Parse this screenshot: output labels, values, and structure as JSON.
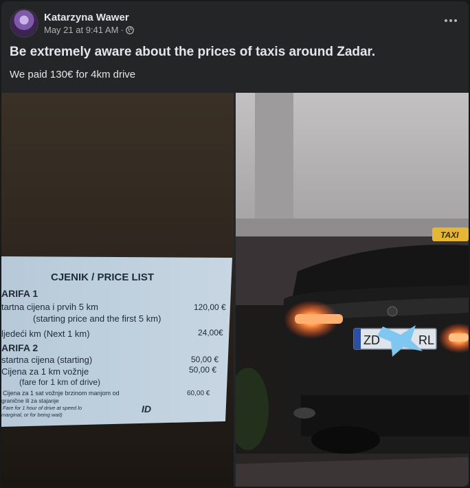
{
  "post": {
    "author": "Katarzyna Wawer",
    "timestamp": "May 21 at 9:41 AM",
    "separator": "·",
    "privacy_icon": "globe-icon",
    "more_icon": "more-horizontal-icon",
    "headline": "Be extremely aware about the prices of taxis around Zadar.",
    "body": "We paid 130€ for 4km drive"
  },
  "price_list": {
    "title": "CJENIK / PRICE LIST",
    "tariff1": "ARIFA 1",
    "row1_label": "tartna cijena i prvih 5 km",
    "row1_value": "120,00 €",
    "row1_en": "(starting price and the first 5 km)",
    "row2_label": "ljedeći km (Next 1 km)",
    "row2_value": "24,00€",
    "tariff2": "ARIFA 2",
    "row3_label": "startna cijena (starting)",
    "row3_value": "50,00 €",
    "row4_label": "Cijena za 1 km vožnje",
    "row4_value": "50,00 €",
    "row4_en": "(fare for 1 km of drive)",
    "row5_label": "Cijena za 1 sat vožnje brzinom manjom od",
    "row5_value": "60,00 €",
    "fine1": "granične ili za stajanje",
    "fine2": "Fare for 1 hour of drive at speed lo",
    "fine3": "marginal, or for being wait)",
    "logo": "ID"
  },
  "car_photo": {
    "taxi_sign": "TAXI",
    "plate_left": "ZD",
    "plate_right": "RL"
  }
}
